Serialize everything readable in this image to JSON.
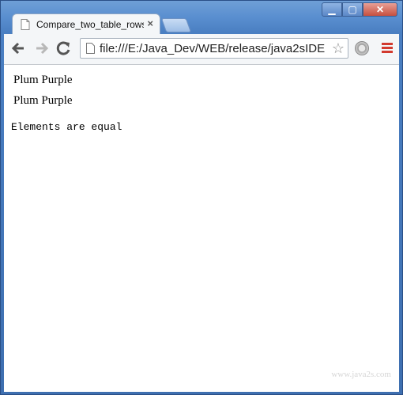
{
  "browser": {
    "tab_title": "Compare_two_table_rows",
    "address": "file:///E:/Java_Dev/WEB/release/java2sIDE",
    "minimize_glyph": "▁",
    "maximize_glyph": "▢",
    "close_glyph": "✕",
    "tab_close_glyph": "×"
  },
  "page": {
    "rows": [
      "Plum Purple",
      "Plum Purple"
    ],
    "output": "Elements are equal",
    "watermark": "www.java2s.com"
  },
  "icons": {
    "back": "back-arrow-icon",
    "forward": "forward-arrow-icon",
    "reload": "reload-icon",
    "star": "bookmark-star-icon",
    "menu": "hamburger-menu-icon",
    "extension": "extension-icon"
  },
  "colors": {
    "frame": "#4a7fc2",
    "menu_accent": "#d23a2e"
  }
}
